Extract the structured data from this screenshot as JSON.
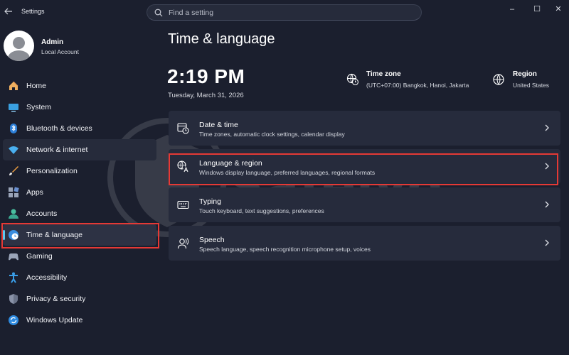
{
  "window": {
    "title": "Settings",
    "controls": {
      "minimize": "–",
      "maximize": "☐",
      "close": "✕"
    }
  },
  "search": {
    "placeholder": "Find a setting"
  },
  "profile": {
    "name": "Admin",
    "account_type": "Local Account"
  },
  "sidebar": {
    "items": [
      {
        "label": "Home",
        "icon": "home-icon"
      },
      {
        "label": "System",
        "icon": "monitor-icon"
      },
      {
        "label": "Bluetooth & devices",
        "icon": "bluetooth-icon"
      },
      {
        "label": "Network & internet",
        "icon": "wifi-icon"
      },
      {
        "label": "Personalization",
        "icon": "brush-icon"
      },
      {
        "label": "Apps",
        "icon": "apps-icon"
      },
      {
        "label": "Accounts",
        "icon": "person-icon"
      },
      {
        "label": "Time & language",
        "icon": "globe-clock-icon",
        "selected": true
      },
      {
        "label": "Gaming",
        "icon": "controller-icon"
      },
      {
        "label": "Accessibility",
        "icon": "accessibility-icon"
      },
      {
        "label": "Privacy & security",
        "icon": "shield-icon"
      },
      {
        "label": "Windows Update",
        "icon": "update-icon"
      }
    ]
  },
  "main": {
    "title": "Time & language",
    "time": "2:19 PM",
    "date": "Tuesday, March 31, 2026",
    "time_zone": {
      "title": "Time zone",
      "value": "(UTC+07:00) Bangkok, Hanoi, Jakarta"
    },
    "region": {
      "title": "Region",
      "value": "United States"
    },
    "cards": [
      {
        "title": "Date & time",
        "subtitle": "Time zones, automatic clock settings, calendar display",
        "icon": "calendar-clock-icon"
      },
      {
        "title": "Language & region",
        "subtitle": "Windows display language, preferred languages, regional formats",
        "icon": "language-icon",
        "highlighted": true
      },
      {
        "title": "Typing",
        "subtitle": "Touch keyboard, text suggestions, preferences",
        "icon": "keyboard-icon"
      },
      {
        "title": "Speech",
        "subtitle": "Speech language, speech recognition microphone setup, voices",
        "icon": "speech-icon"
      }
    ]
  },
  "watermark": {
    "text": "Safelyo"
  },
  "colors": {
    "background": "#1b1f2e",
    "card": "#262b3c",
    "highlight": "#e53935",
    "accent": "#5cc8f0"
  }
}
